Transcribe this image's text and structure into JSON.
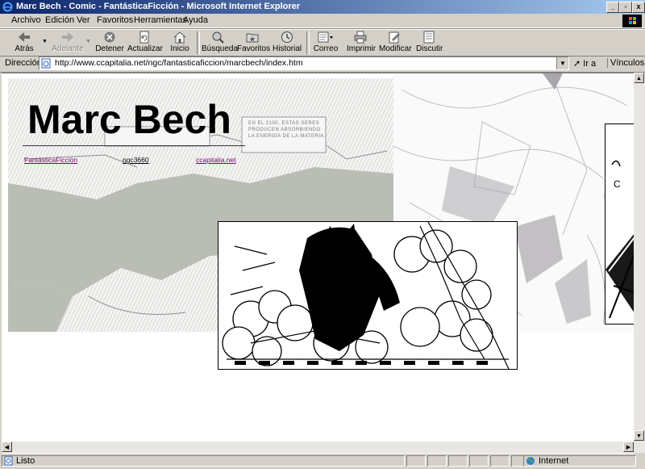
{
  "window": {
    "title": "Marc Bech - Comic - FantásticaFicción - Microsoft Internet Explorer",
    "buttons": [
      "_",
      "▫",
      "x"
    ]
  },
  "menu": {
    "items": [
      "Archivo",
      "Edición",
      "Ver",
      "Favoritos",
      "Herramientas",
      "Ayuda"
    ]
  },
  "toolbar": {
    "back": "Atrás",
    "forward": "Adelante",
    "stop": "Detener",
    "refresh": "Actualizar",
    "home": "Inicio",
    "search": "Búsqueda",
    "favorites": "Favoritos",
    "history": "Historial",
    "mail": "Correo",
    "print": "Imprimir",
    "edit": "Modificar",
    "discuss": "Discutir"
  },
  "address": {
    "label": "Dirección",
    "url": "http://www.ccapitalia.net/ngc/fantasticaficcion/marcbech/index.htm",
    "go": "Ir a",
    "links": "Vínculos"
  },
  "page": {
    "heading": "Marc Bech",
    "links": [
      "FantásticaFicción",
      "ngc3660",
      "ccapitalia.net"
    ],
    "speech_text": "EN EL 2100, ESTAS SERES PRODUCEN ABSORBIENDO LA ENERGÍA DE LA MATERIA"
  },
  "status": {
    "text": "Listo",
    "zone": "Internet"
  },
  "colors": {
    "titlebar_start": "#0a246a",
    "titlebar_end": "#a6caf0",
    "chrome": "#d4d0c8",
    "sage": "#b9bdb4",
    "visited_link": "#800080"
  }
}
